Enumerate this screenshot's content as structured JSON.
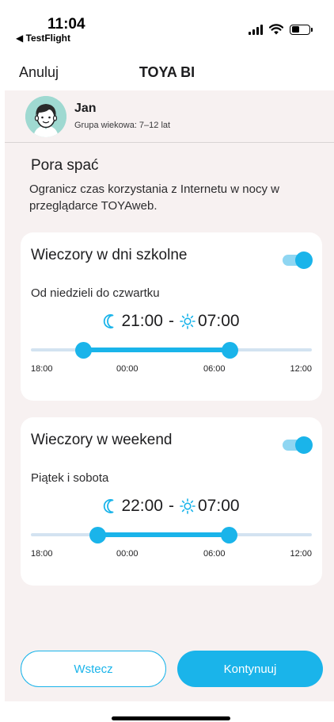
{
  "status_bar": {
    "time": "11:04",
    "back_app": "◀ TestFlight",
    "icons": [
      "signal-icon",
      "wifi-icon",
      "battery-icon"
    ]
  },
  "nav": {
    "cancel_label": "Anuluj",
    "title": "TOYA BI"
  },
  "profile": {
    "name": "Jan",
    "age_group": "Grupa wiekowa: 7–12 lat",
    "avatar_icon": "boy-avatar-icon"
  },
  "section": {
    "title": "Pora spać",
    "description": "Ogranicz czas korzystania z Internetu w nocy w przeglądarce TOYAweb."
  },
  "schedules": [
    {
      "title": "Wieczory w dni szkolne",
      "days": "Od niedzieli do czwartku",
      "enabled": true,
      "start": "21:00",
      "end": "07:00",
      "separator": "-",
      "ticks": [
        "18:00",
        "00:00",
        "06:00",
        "12:00"
      ]
    },
    {
      "title": "Wieczory w weekend",
      "days": "Piątek i sobota",
      "enabled": true,
      "start": "22:00",
      "end": "07:00",
      "separator": "-",
      "ticks": [
        "18:00",
        "00:00",
        "06:00",
        "12:00"
      ]
    }
  ],
  "buttons": {
    "back_label": "Wstecz",
    "continue_label": "Kontynuuj"
  },
  "colors": {
    "accent": "#1ab4ea",
    "background": "#f7f1f1",
    "avatar_bg": "#9fd9d1"
  }
}
